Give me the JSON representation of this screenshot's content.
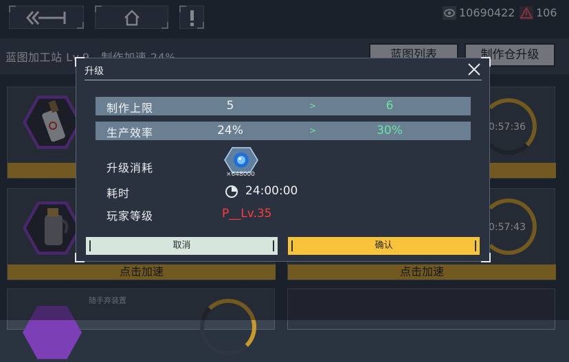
{
  "top_bar": {
    "back_icon": "back-arrow-icon",
    "home_icon": "home-icon",
    "alert_icon": "exclamation-icon",
    "currency_1": {
      "icon": "eye-token-icon",
      "value": "10690422"
    },
    "currency_2": {
      "icon": "warning-triangle-icon",
      "value": "106"
    }
  },
  "station": {
    "title": "蓝图加工站 Lv.9   制作加速 24%",
    "blueprint_list_btn": "蓝图列表",
    "upgrade_btn": "制作仓升级"
  },
  "cards": [
    {
      "timer": "0:57:36",
      "speed_label": "点击加速"
    },
    {
      "timer": "0:57:43",
      "speed_label": "点击加速"
    },
    {
      "speed_label": "点击加速"
    },
    {
      "caption": "随手弃装置"
    }
  ],
  "dialog": {
    "title": "升级",
    "rows": [
      {
        "label": "制作上限",
        "current": "5",
        "arrow": ">",
        "next": "6"
      },
      {
        "label": "生产效率",
        "current": "24%",
        "arrow": ">",
        "next": "30%"
      }
    ],
    "cost_label": "升级消耗",
    "cost_amount": "×648000",
    "time_label": "耗时",
    "time_value": "24:00:00",
    "level_label": "玩家等级",
    "level_value": "P__Lv.35",
    "cancel_label": "取消",
    "confirm_label": "确认",
    "colors": {
      "accent_gold": "#f7c33a",
      "increase_green": "#67e6a4",
      "requirement_red": "#ff3b3b"
    }
  }
}
